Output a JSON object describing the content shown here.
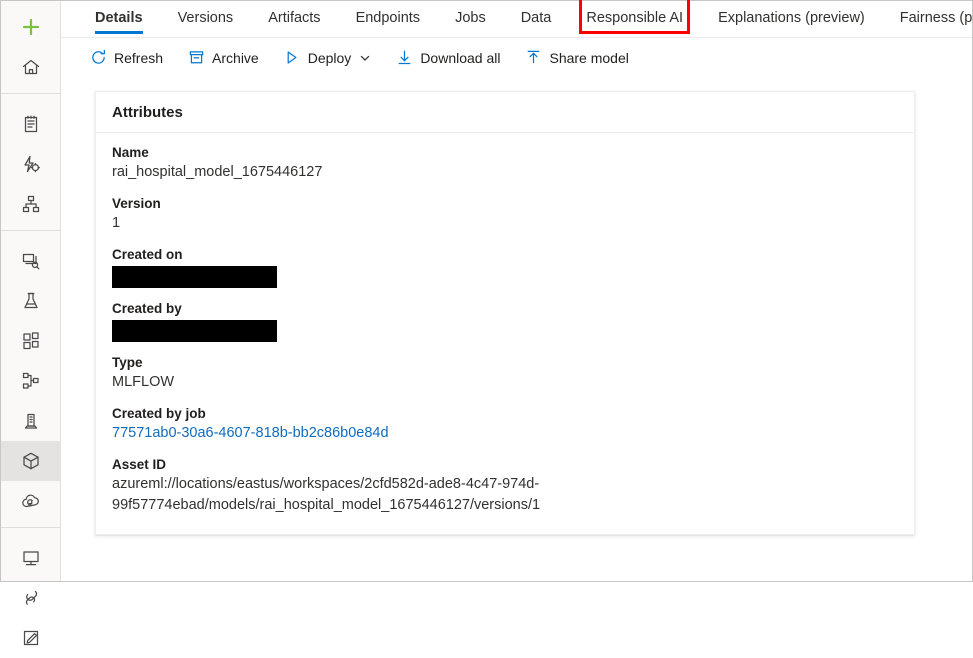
{
  "sidebar": {
    "groups": [
      {
        "items": [
          {
            "name": "new-button",
            "icon": "plus-icon",
            "label": "New"
          },
          {
            "name": "home",
            "icon": "home-icon",
            "label": "Home"
          }
        ]
      },
      {
        "items": [
          {
            "name": "notebooks",
            "icon": "notebook-icon",
            "label": "Notebooks"
          },
          {
            "name": "automated-ml",
            "icon": "automated-ml-icon",
            "label": "Automated ML"
          },
          {
            "name": "designer",
            "icon": "designer-icon",
            "label": "Designer"
          }
        ]
      },
      {
        "items": [
          {
            "name": "data-labeling",
            "icon": "data-labeling-icon",
            "label": "Data labeling"
          },
          {
            "name": "jobs",
            "icon": "flask-icon",
            "label": "Jobs"
          },
          {
            "name": "components",
            "icon": "components-icon",
            "label": "Components"
          },
          {
            "name": "pipelines",
            "icon": "pipelines-icon",
            "label": "Pipelines"
          },
          {
            "name": "data",
            "icon": "data-icon",
            "label": "Data"
          },
          {
            "name": "models",
            "icon": "cube-icon",
            "label": "Models",
            "selected": true
          },
          {
            "name": "endpoints",
            "icon": "cloud-endpoints-icon",
            "label": "Endpoints"
          }
        ]
      },
      {
        "items": [
          {
            "name": "compute",
            "icon": "monitor-icon",
            "label": "Compute"
          },
          {
            "name": "linked-services",
            "icon": "plug-icon",
            "label": "Linked Services"
          },
          {
            "name": "data-labeling-projects",
            "icon": "pencil-square-icon",
            "label": "Data Labeling"
          }
        ]
      }
    ]
  },
  "tabs": [
    {
      "label": "Details",
      "active": true,
      "highlight": false
    },
    {
      "label": "Versions",
      "active": false,
      "highlight": false
    },
    {
      "label": "Artifacts",
      "active": false,
      "highlight": false
    },
    {
      "label": "Endpoints",
      "active": false,
      "highlight": false
    },
    {
      "label": "Jobs",
      "active": false,
      "highlight": false
    },
    {
      "label": "Data",
      "active": false,
      "highlight": false
    },
    {
      "label": "Responsible AI",
      "active": false,
      "highlight": true
    },
    {
      "label": "Explanations (preview)",
      "active": false,
      "highlight": false
    },
    {
      "label": "Fairness (preview)",
      "active": false,
      "highlight": false
    }
  ],
  "toolbar": {
    "commands": [
      {
        "name": "refresh-button",
        "label": "Refresh",
        "icon": "refresh-icon",
        "chevron": false
      },
      {
        "name": "archive-button",
        "label": "Archive",
        "icon": "archive-icon",
        "chevron": false
      },
      {
        "name": "deploy-button",
        "label": "Deploy",
        "icon": "play-icon",
        "chevron": true
      },
      {
        "name": "download-all-button",
        "label": "Download all",
        "icon": "download-icon",
        "chevron": false
      },
      {
        "name": "share-model-button",
        "label": "Share model",
        "icon": "share-icon",
        "chevron": false
      }
    ]
  },
  "card": {
    "title": "Attributes",
    "attributes": [
      {
        "name": "name",
        "label": "Name",
        "value": "rai_hospital_model_1675446127",
        "type": "text"
      },
      {
        "name": "version",
        "label": "Version",
        "value": "1",
        "type": "text"
      },
      {
        "name": "created-on",
        "label": "Created on",
        "value": "",
        "type": "redacted"
      },
      {
        "name": "created-by",
        "label": "Created by",
        "value": "",
        "type": "redacted"
      },
      {
        "name": "type",
        "label": "Type",
        "value": "MLFLOW",
        "type": "text"
      },
      {
        "name": "created-by-job",
        "label": "Created by job",
        "value": "77571ab0-30a6-4607-818b-bb2c86b0e84d",
        "type": "link"
      },
      {
        "name": "asset-id",
        "label": "Asset ID",
        "value": "azureml://locations/eastus/workspaces/2cfd582d-ade8-4c47-974d-99f57774ebad/models/rai_hospital_model_1675446127/versions/1",
        "type": "wrap"
      }
    ]
  },
  "colors": {
    "accent": "#0078d4",
    "link": "#0f6cbd",
    "highlight": "#ff0000",
    "new_green": "#7ac143",
    "sidebar_bg": "#faf9f8"
  }
}
